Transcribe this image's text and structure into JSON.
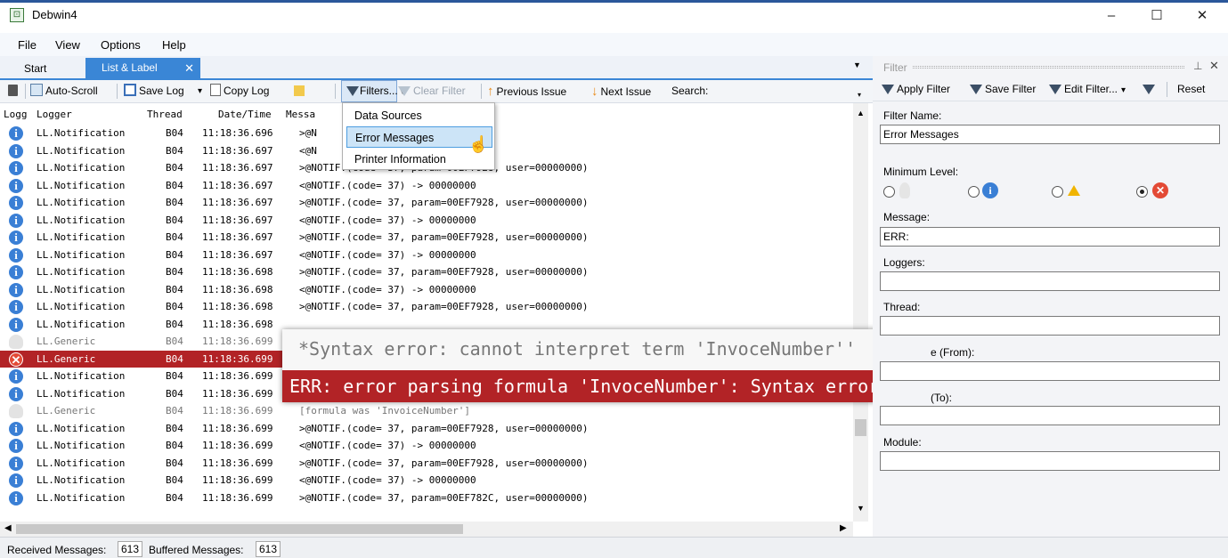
{
  "window": {
    "title": "Debwin4",
    "minimize": "–",
    "maximize": "☐",
    "close": "✕"
  },
  "menu": [
    "File",
    "View",
    "Options",
    "Help"
  ],
  "tabs": {
    "start": "Start",
    "active": "List & Label",
    "close": "✕",
    "dropdown": "▼"
  },
  "toolbar": {
    "auto_scroll": "Auto-Scroll",
    "save_log": "Save Log",
    "save_dropdown": "▾",
    "copy_log": "Copy Log",
    "filters": "Filters...",
    "filters_dropdown": "▾",
    "clear_filter": "Clear Filter",
    "previous_issue": "Previous Issue",
    "next_issue": "Next Issue",
    "search": "Search:"
  },
  "filters_menu": [
    "Data Sources",
    "Error Messages",
    "Printer Information"
  ],
  "grid": {
    "columns": [
      "Logg",
      "Logger",
      "Thread",
      "Date/Time",
      "Messa"
    ],
    "rows": [
      {
        "level": "info",
        "logger": "LL.Notification",
        "thread": "B04",
        "time": "11:18:36.696",
        "message": ">@N"
      },
      {
        "level": "info",
        "logger": "LL.Notification",
        "thread": "B04",
        "time": "11:18:36.697",
        "message": "<@N"
      },
      {
        "level": "info",
        "logger": "LL.Notification",
        "thread": "B04",
        "time": "11:18:36.697",
        "message": ">@NOTIF.(code= 37, param=00EF7928, user=00000000)"
      },
      {
        "level": "info",
        "logger": "LL.Notification",
        "thread": "B04",
        "time": "11:18:36.697",
        "message": "<@NOTIF.(code= 37) -> 00000000"
      },
      {
        "level": "info",
        "logger": "LL.Notification",
        "thread": "B04",
        "time": "11:18:36.697",
        "message": ">@NOTIF.(code= 37, param=00EF7928, user=00000000)"
      },
      {
        "level": "info",
        "logger": "LL.Notification",
        "thread": "B04",
        "time": "11:18:36.697",
        "message": "<@NOTIF.(code= 37) -> 00000000"
      },
      {
        "level": "info",
        "logger": "LL.Notification",
        "thread": "B04",
        "time": "11:18:36.697",
        "message": ">@NOTIF.(code= 37, param=00EF7928, user=00000000)"
      },
      {
        "level": "info",
        "logger": "LL.Notification",
        "thread": "B04",
        "time": "11:18:36.697",
        "message": "<@NOTIF.(code= 37) -> 00000000"
      },
      {
        "level": "info",
        "logger": "LL.Notification",
        "thread": "B04",
        "time": "11:18:36.698",
        "message": ">@NOTIF.(code= 37, param=00EF7928, user=00000000)"
      },
      {
        "level": "info",
        "logger": "LL.Notification",
        "thread": "B04",
        "time": "11:18:36.698",
        "message": "<@NOTIF.(code= 37) -> 00000000"
      },
      {
        "level": "info",
        "logger": "LL.Notification",
        "thread": "B04",
        "time": "11:18:36.698",
        "message": ">@NOTIF.(code= 37, param=00EF7928, user=00000000)"
      },
      {
        "level": "info",
        "logger": "LL.Notification",
        "thread": "B04",
        "time": "11:18:36.698",
        "message": ""
      },
      {
        "level": "generic",
        "logger": "LL.Generic",
        "thread": "B04",
        "time": "11:18:36.699",
        "message": ""
      },
      {
        "level": "error",
        "logger": "LL.Generic",
        "thread": "B04",
        "time": "11:18:36.699",
        "message": ""
      },
      {
        "level": "info",
        "logger": "LL.Notification",
        "thread": "B04",
        "time": "11:18:36.699",
        "message": ""
      },
      {
        "level": "info",
        "logger": "LL.Notification",
        "thread": "B04",
        "time": "11:18:36.699",
        "message": ""
      },
      {
        "level": "generic",
        "logger": "LL.Generic",
        "thread": "B04",
        "time": "11:18:36.699",
        "message": "  [formula was 'InvoiceNumber']"
      },
      {
        "level": "info",
        "logger": "LL.Notification",
        "thread": "B04",
        "time": "11:18:36.699",
        "message": ">@NOTIF.(code= 37, param=00EF7928, user=00000000)"
      },
      {
        "level": "info",
        "logger": "LL.Notification",
        "thread": "B04",
        "time": "11:18:36.699",
        "message": "<@NOTIF.(code= 37) -> 00000000"
      },
      {
        "level": "info",
        "logger": "LL.Notification",
        "thread": "B04",
        "time": "11:18:36.699",
        "message": ">@NOTIF.(code= 37, param=00EF7928, user=00000000)"
      },
      {
        "level": "info",
        "logger": "LL.Notification",
        "thread": "B04",
        "time": "11:18:36.699",
        "message": "<@NOTIF.(code= 37) -> 00000000"
      },
      {
        "level": "info",
        "logger": "LL.Notification",
        "thread": "B04",
        "time": "11:18:36.699",
        "message": ">@NOTIF.(code= 37, param=00EF782C, user=00000000)"
      }
    ]
  },
  "zoom": {
    "line1": "*Syntax error: cannot interpret term 'InvoceNumber''",
    "line2": "ERR: error parsing formula 'InvoceNumber': Syntax error:"
  },
  "filter_panel": {
    "title": "Filter",
    "pin": "⊥",
    "close": "✕",
    "apply": "Apply Filter",
    "save": "Save Filter",
    "edit": "Edit Filter...",
    "edit_dropdown": "▾",
    "reset": "Reset",
    "filter_name_label": "Filter Name:",
    "filter_name_value": "Error Messages",
    "min_level_label": "Minimum Level:",
    "selected_level": "error",
    "message_label": "Message:",
    "message_value": "ERR:",
    "loggers_label": "Loggers:",
    "thread_label": "Thread:",
    "from_label": "e (From):",
    "to_label": "(To):",
    "module_label": "Module:"
  },
  "status": {
    "received_label": "Received Messages:",
    "received_value": "613",
    "buffered_label": "Buffered Messages:",
    "buffered_value": "613"
  },
  "colors": {
    "accent": "#3a86d6",
    "error_row": "#b22326",
    "info_icon": "#3a7fd5",
    "error_icon": "#e34a36"
  }
}
